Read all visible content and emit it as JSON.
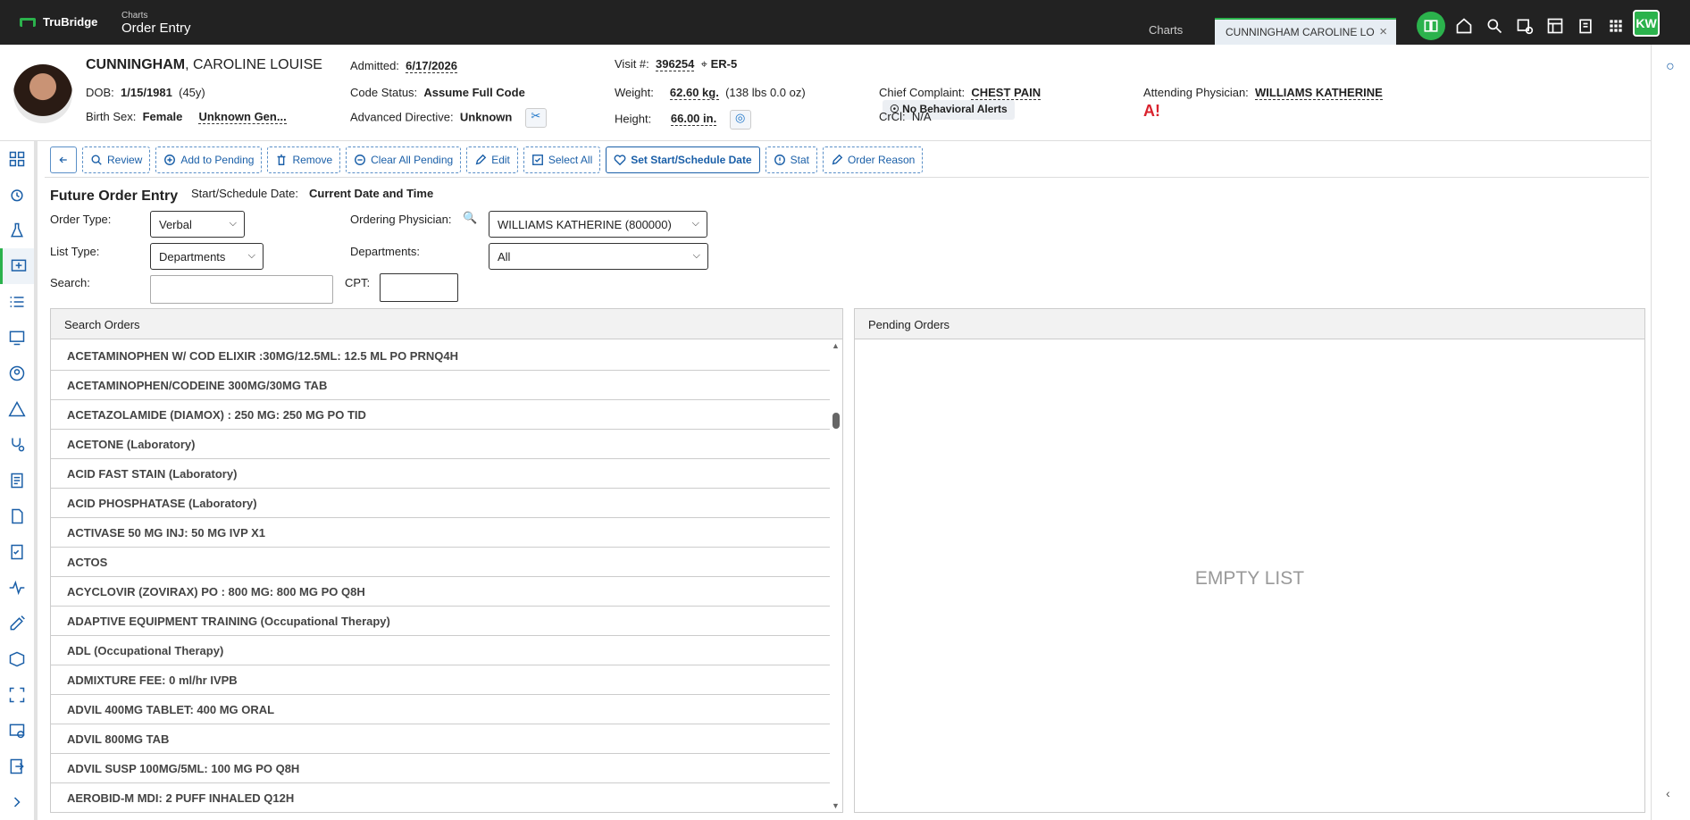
{
  "app": {
    "brand": "TruBridge",
    "breadcrumb_small": "Charts",
    "breadcrumb_title": "Order Entry"
  },
  "tabs": {
    "charts_label": "Charts",
    "patient_tab": "CUNNINGHAM CAROLINE LO",
    "close_icon": "close-icon"
  },
  "user": {
    "initials": "KW"
  },
  "colors": {
    "accent": "#2bb24c",
    "link": "#1a5fa8",
    "alert": "#d9232e",
    "topbar": "#222222"
  },
  "patient": {
    "last_name": "CUNNINGHAM",
    "first_names": ", CAROLINE LOUISE",
    "dob_label": "DOB:",
    "dob": "1/15/1981",
    "age": "(45y)",
    "birth_sex_label": "Birth Sex:",
    "birth_sex": "Female",
    "gender": "Unknown Gen...",
    "admitted_label": "Admitted:",
    "admitted": "6/17/2026",
    "code_status_label": "Code Status:",
    "code_status": "Assume Full Code",
    "adv_directive_label": "Advanced Directive:",
    "adv_directive": "Unknown",
    "visit_label": "Visit #:",
    "visit": "396254",
    "location": "ER-5",
    "weight_label": "Weight:",
    "weight": "62.60 kg.",
    "weight_lbs": "(138 lbs 0.0 oz)",
    "height_label": "Height:",
    "height": "66.00 in.",
    "behavioral_alert": "No Behavioral Alerts",
    "complaint_label": "Chief Complaint:",
    "complaint": "CHEST PAIN",
    "crcl_label": "CrCl:",
    "crcl": "N/A",
    "attending_label": "Attending Physician:",
    "attending": "WILLIAMS KATHERINE",
    "warning_text": "A!"
  },
  "toolbar": {
    "review": "Review",
    "add_pending": "Add to Pending",
    "remove": "Remove",
    "clear_pending": "Clear All Pending",
    "edit": "Edit",
    "select_all": "Select All",
    "set_start": "Set Start/Schedule Date",
    "stat": "Stat",
    "order_reason": "Order Reason"
  },
  "form": {
    "title": "Future Order Entry",
    "start_label": "Start/Schedule Date:",
    "start_value": "Current Date and Time",
    "order_type_label": "Order Type:",
    "order_type": "Verbal",
    "ordering_label": "Ordering Physician:",
    "ordering": "WILLIAMS KATHERINE (800000)",
    "list_type_label": "List Type:",
    "list_type": "Departments",
    "departments_label": "Departments:",
    "departments": "All",
    "search_label": "Search:",
    "search_value": "",
    "cpt_label": "CPT:",
    "cpt_value": ""
  },
  "search_orders": {
    "title": "Search Orders",
    "rows": [
      "ACETAMINOPHEN W/ COD ELIXIR :30MG/12.5ML: 12.5 ML PO PRNQ4H",
      "ACETAMINOPHEN/CODEINE 300MG/30MG TAB",
      "ACETAZOLAMIDE (DIAMOX) : 250 MG: 250 MG PO TID",
      "ACETONE (Laboratory)",
      "ACID FAST STAIN (Laboratory)",
      "ACID PHOSPHATASE (Laboratory)",
      "ACTIVASE 50 MG INJ: 50 MG IVP X1",
      "ACTOS",
      "ACYCLOVIR (ZOVIRAX) PO : 800 MG: 800 MG PO Q8H",
      "ADAPTIVE EQUIPMENT TRAINING (Occupational Therapy)",
      "ADL (Occupational Therapy)",
      "ADMIXTURE FEE: 0 ml/hr IVPB",
      "ADVIL 400MG TABLET: 400 MG ORAL",
      "ADVIL 800MG TAB",
      "ADVIL SUSP 100MG/5ML: 100 MG PO Q8H",
      "AEROBID-M MDI: 2 PUFF INHALED Q12H"
    ]
  },
  "pending_orders": {
    "title": "Pending Orders",
    "empty_text": "EMPTY LIST"
  }
}
